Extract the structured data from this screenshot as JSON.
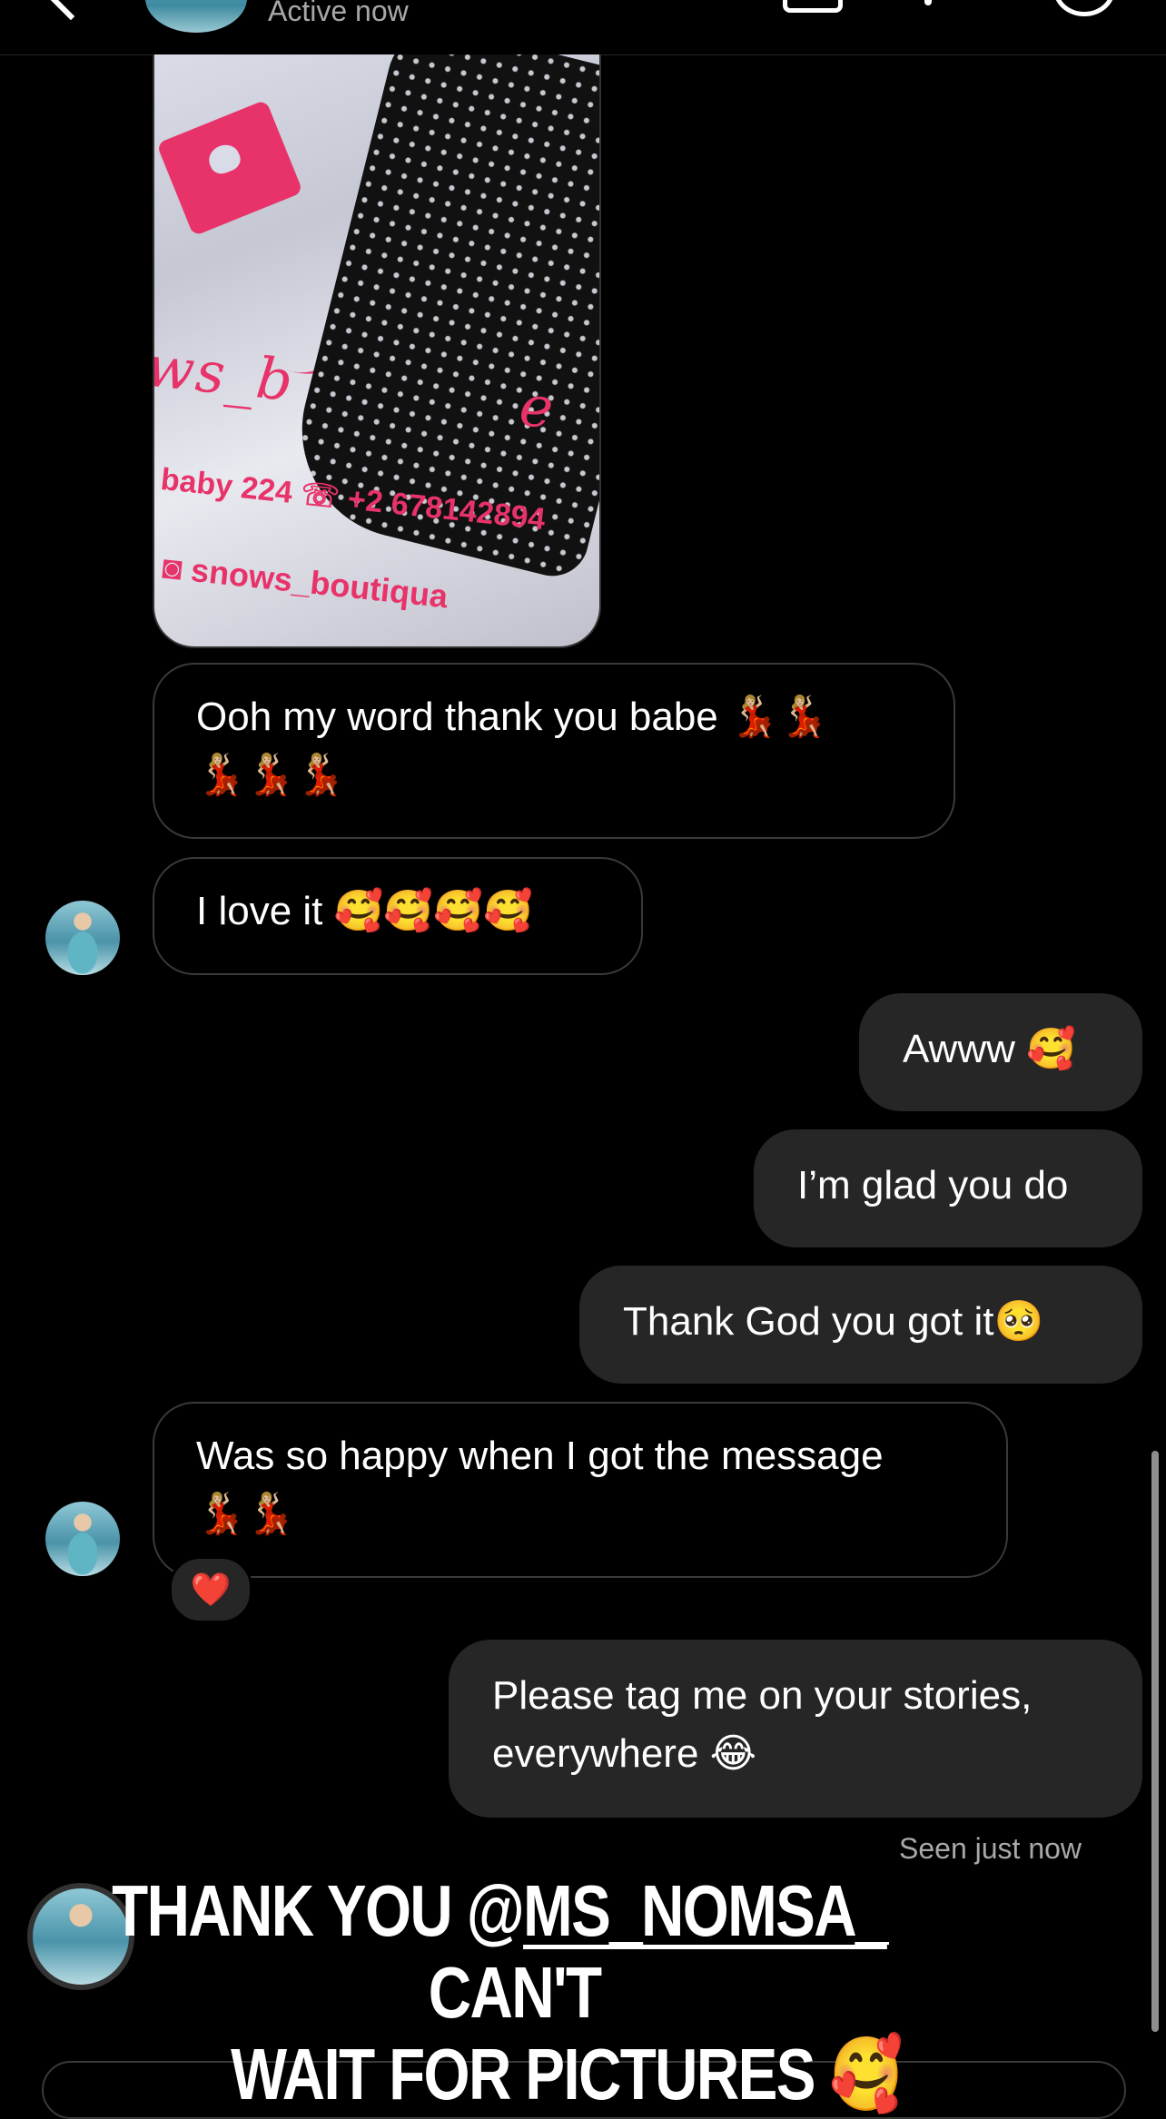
{
  "header": {
    "status": "Active now",
    "icons": [
      "chevron-left-icon",
      "video-call-icon",
      "phone-icon",
      "info-icon"
    ]
  },
  "photo": {
    "brand_text": "ws_b",
    "brand_suffix": "e",
    "contact_text": "baby 224 ☏ +2 678142894",
    "handle_text": "◙ snows_boutiqua"
  },
  "messages": [
    {
      "from": "them",
      "text": "Ooh my word thank you babe 💃🏼💃🏼",
      "text2": "💃🏼💃🏼💃🏼"
    },
    {
      "from": "them",
      "text": "I love it 🥰🥰🥰🥰"
    },
    {
      "from": "me",
      "text": "Awww 🥰"
    },
    {
      "from": "me",
      "text": "I’m glad you do"
    },
    {
      "from": "me",
      "text": "Thank God you got it🥺"
    },
    {
      "from": "them",
      "text": "Was so happy when I got the message",
      "text2": "💃🏼💃🏼",
      "reaction": "❤️"
    },
    {
      "from": "me",
      "text": "Please tag me on your stories,",
      "text2": "everywhere 😂"
    }
  ],
  "seen": "Seen just now",
  "overlay": {
    "line1_prefix": "THANK YOU @",
    "mention": "MS_NOMSA_",
    "line1_suffix": "  CAN'T",
    "line2": "WAIT FOR PICTURES 🥰"
  }
}
